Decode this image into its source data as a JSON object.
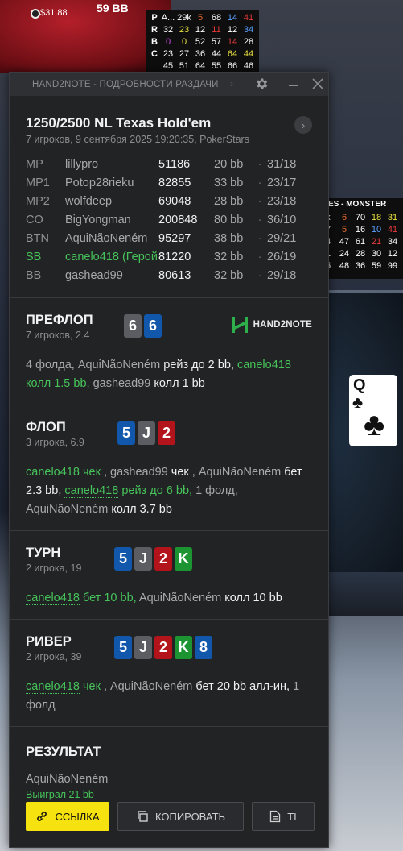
{
  "background": {
    "seat_name": "59 BB",
    "seat_stack": "$31.88",
    "hud_rows": [
      {
        "letter": "P",
        "cells": [
          {
            "v": "A...",
            "c": "#ffffff"
          },
          {
            "v": "29k",
            "c": "#ffffff"
          },
          {
            "v": "5",
            "c": "#e86b2a"
          },
          {
            "v": "68",
            "c": "#ffffff"
          },
          {
            "v": "14",
            "c": "#5aa0ff"
          },
          {
            "v": "41",
            "c": "#e83a3a"
          }
        ]
      },
      {
        "letter": "R",
        "cells": [
          {
            "v": "32",
            "c": "#ffffff"
          },
          {
            "v": "23",
            "c": "#e8e040"
          },
          {
            "v": "12",
            "c": "#ffffff"
          },
          {
            "v": "11",
            "c": "#e83a3a"
          },
          {
            "v": "12",
            "c": "#ffffff"
          },
          {
            "v": "34",
            "c": "#5aa0ff"
          }
        ]
      },
      {
        "letter": "B",
        "cells": [
          {
            "v": "0",
            "c": "#c84ae0"
          },
          {
            "v": "0",
            "c": "#e8e040"
          },
          {
            "v": "52",
            "c": "#ffffff"
          },
          {
            "v": "57",
            "c": "#ffffff"
          },
          {
            "v": "14",
            "c": "#e83a3a"
          },
          {
            "v": "28",
            "c": "#ffffff"
          }
        ]
      },
      {
        "letter": "C",
        "cells": [
          {
            "v": "23",
            "c": "#ffffff"
          },
          {
            "v": "27",
            "c": "#ffffff"
          },
          {
            "v": "36",
            "c": "#ffffff"
          },
          {
            "v": "44",
            "c": "#ffffff"
          },
          {
            "v": "64",
            "c": "#e8e040"
          },
          {
            "v": "44",
            "c": "#e8e040"
          }
        ]
      },
      {
        "letter": "",
        "cells": [
          {
            "v": "45",
            "c": "#ffffff"
          },
          {
            "v": "51",
            "c": "#ffffff"
          },
          {
            "v": "64",
            "c": "#ffffff"
          },
          {
            "v": "55",
            "c": "#ffffff"
          },
          {
            "v": "66",
            "c": "#ffffff"
          },
          {
            "v": "46",
            "c": "#ffffff"
          }
        ]
      }
    ],
    "right_hud_title": "RIES - MONSTER",
    "right_hud_rows": [
      [
        {
          "v": "k",
          "c": "#ffffff"
        },
        {
          "v": "6",
          "c": "#e86b2a"
        },
        {
          "v": "70",
          "c": "#ffffff"
        },
        {
          "v": "18",
          "c": "#e8e040"
        },
        {
          "v": "31",
          "c": "#e8e040"
        }
      ],
      [
        {
          "v": "7",
          "c": "#ffffff"
        },
        {
          "v": "5",
          "c": "#e86b2a"
        },
        {
          "v": "16",
          "c": "#ffffff"
        },
        {
          "v": "10",
          "c": "#5aa0ff"
        },
        {
          "v": "41",
          "c": "#e83a3a"
        }
      ],
      [
        {
          "v": "4",
          "c": "#ffffff"
        },
        {
          "v": "47",
          "c": "#ffffff"
        },
        {
          "v": "61",
          "c": "#ffffff"
        },
        {
          "v": "21",
          "c": "#e83a3a"
        },
        {
          "v": "34",
          "c": "#ffffff"
        }
      ],
      [
        {
          "v": "1",
          "c": "#ffffff"
        },
        {
          "v": "24",
          "c": "#ffffff"
        },
        {
          "v": "28",
          "c": "#ffffff"
        },
        {
          "v": "30",
          "c": "#ffffff"
        },
        {
          "v": "12",
          "c": "#ffffff"
        }
      ],
      [
        {
          "v": "5",
          "c": "#ffffff"
        },
        {
          "v": "48",
          "c": "#ffffff"
        },
        {
          "v": "36",
          "c": "#ffffff"
        },
        {
          "v": "59",
          "c": "#ffffff"
        },
        {
          "v": "99",
          "c": "#ffffff"
        }
      ]
    ],
    "table_card": {
      "rank": "Q",
      "suit": "♣"
    }
  },
  "window": {
    "title": "HAND2NOTE - ПОДРОБНОСТИ РАЗДАЧИ"
  },
  "header": {
    "game": "1250/2500 NL Texas Hold'em",
    "subtitle": "7 игроков, 9 сентября 2025 19:20:35, PokerStars"
  },
  "players": [
    {
      "pos": "MP",
      "name": "lillypro",
      "stack": "51186",
      "bb": "20 bb",
      "stat": "31/18",
      "hero": false
    },
    {
      "pos": "MP1",
      "name": "Potop28rieku",
      "stack": "82855",
      "bb": "33 bb",
      "stat": "23/17",
      "hero": false
    },
    {
      "pos": "MP2",
      "name": "wolfdeep",
      "stack": "69048",
      "bb": "28 bb",
      "stat": "23/18",
      "hero": false
    },
    {
      "pos": "CO",
      "name": "BigYongman",
      "stack": "200848",
      "bb": "80 bb",
      "stat": "36/10",
      "hero": false
    },
    {
      "pos": "BTN",
      "name": "AquiNãoNeném",
      "stack": "95297",
      "bb": "38 bb",
      "stat": "29/21",
      "hero": false
    },
    {
      "pos": "SB",
      "name": "canelo418 (Герой)",
      "stack": "81220",
      "bb": "32 bb",
      "stat": "26/19",
      "hero": true
    },
    {
      "pos": "BB",
      "name": "gashead99",
      "stack": "80613",
      "bb": "32 bb",
      "stat": "29/18",
      "hero": false
    }
  ],
  "dot": "·",
  "preflop": {
    "name": "ПРЕФЛОП",
    "sub": "7 игроков, 2.4",
    "cards": [
      {
        "r": "6",
        "color": "gray"
      },
      {
        "r": "6",
        "color": "blue"
      }
    ],
    "logo": "HAND2NOTE",
    "actions": [
      {
        "t": "4 фолда, ",
        "s": "g"
      },
      {
        "t": "AquiNãoNeném",
        "s": "g"
      },
      {
        "t": " рейз до 2 bb,",
        "s": "w"
      },
      {
        "t": " ",
        "s": "g"
      },
      {
        "t": "canelo418",
        "s": "hu"
      },
      {
        "t": " колл 1.5 bb,",
        "s": "h"
      },
      {
        "t": " gashead99",
        "s": "g"
      },
      {
        "t": " колл 1 bb",
        "s": "w"
      }
    ]
  },
  "flop": {
    "name": "ФЛОП",
    "sub": "3 игрока, 6.9",
    "cards": [
      {
        "r": "5",
        "color": "blue"
      },
      {
        "r": "J",
        "color": "gray"
      },
      {
        "r": "2",
        "color": "red"
      }
    ],
    "actions": [
      {
        "t": "canelo418",
        "s": "hu"
      },
      {
        "t": " чек",
        "s": "h"
      },
      {
        "t": " , gashead99",
        "s": "g"
      },
      {
        "t": " чек",
        "s": "w"
      },
      {
        "t": " , AquiNãoNeném",
        "s": "g"
      },
      {
        "t": " бет 2.3 bb,",
        "s": "w"
      },
      {
        "t": " ",
        "s": "g"
      },
      {
        "t": "canelo418",
        "s": "hu"
      },
      {
        "t": " рейз до 6 bb,",
        "s": "h"
      },
      {
        "t": " 1 фолд, AquiNãoNeném",
        "s": "g"
      },
      {
        "t": " колл 3.7 bb",
        "s": "w"
      }
    ]
  },
  "turn": {
    "name": "ТУРН",
    "sub": "2 игрока, 19",
    "cards": [
      {
        "r": "5",
        "color": "blue"
      },
      {
        "r": "J",
        "color": "gray"
      },
      {
        "r": "2",
        "color": "red"
      },
      {
        "r": "K",
        "color": "green"
      }
    ],
    "actions": [
      {
        "t": "canelo418",
        "s": "hu"
      },
      {
        "t": " бет 10 bb,",
        "s": "h"
      },
      {
        "t": " AquiNãoNeném",
        "s": "g"
      },
      {
        "t": " колл 10 bb",
        "s": "w"
      }
    ]
  },
  "river": {
    "name": "РИВЕР",
    "sub": "2 игрока, 39",
    "cards": [
      {
        "r": "5",
        "color": "blue"
      },
      {
        "r": "J",
        "color": "gray"
      },
      {
        "r": "2",
        "color": "red"
      },
      {
        "r": "K",
        "color": "green"
      },
      {
        "r": "8",
        "color": "blue"
      }
    ],
    "actions": [
      {
        "t": "canelo418",
        "s": "hu"
      },
      {
        "t": " чек",
        "s": "h"
      },
      {
        "t": " , AquiNãoNeném",
        "s": "g"
      },
      {
        "t": " бет 20 bb алл-ин,",
        "s": "w"
      },
      {
        "t": " 1 фолд",
        "s": "g"
      }
    ]
  },
  "result": {
    "title": "РЕЗУЛЬТАТ",
    "winner": "AquiNãoNeném",
    "won": "Выиграл 21 bb"
  },
  "buttons": {
    "link": "ССЫЛКА",
    "copy": "КОПИРОВАТЬ",
    "ti": "TI"
  }
}
